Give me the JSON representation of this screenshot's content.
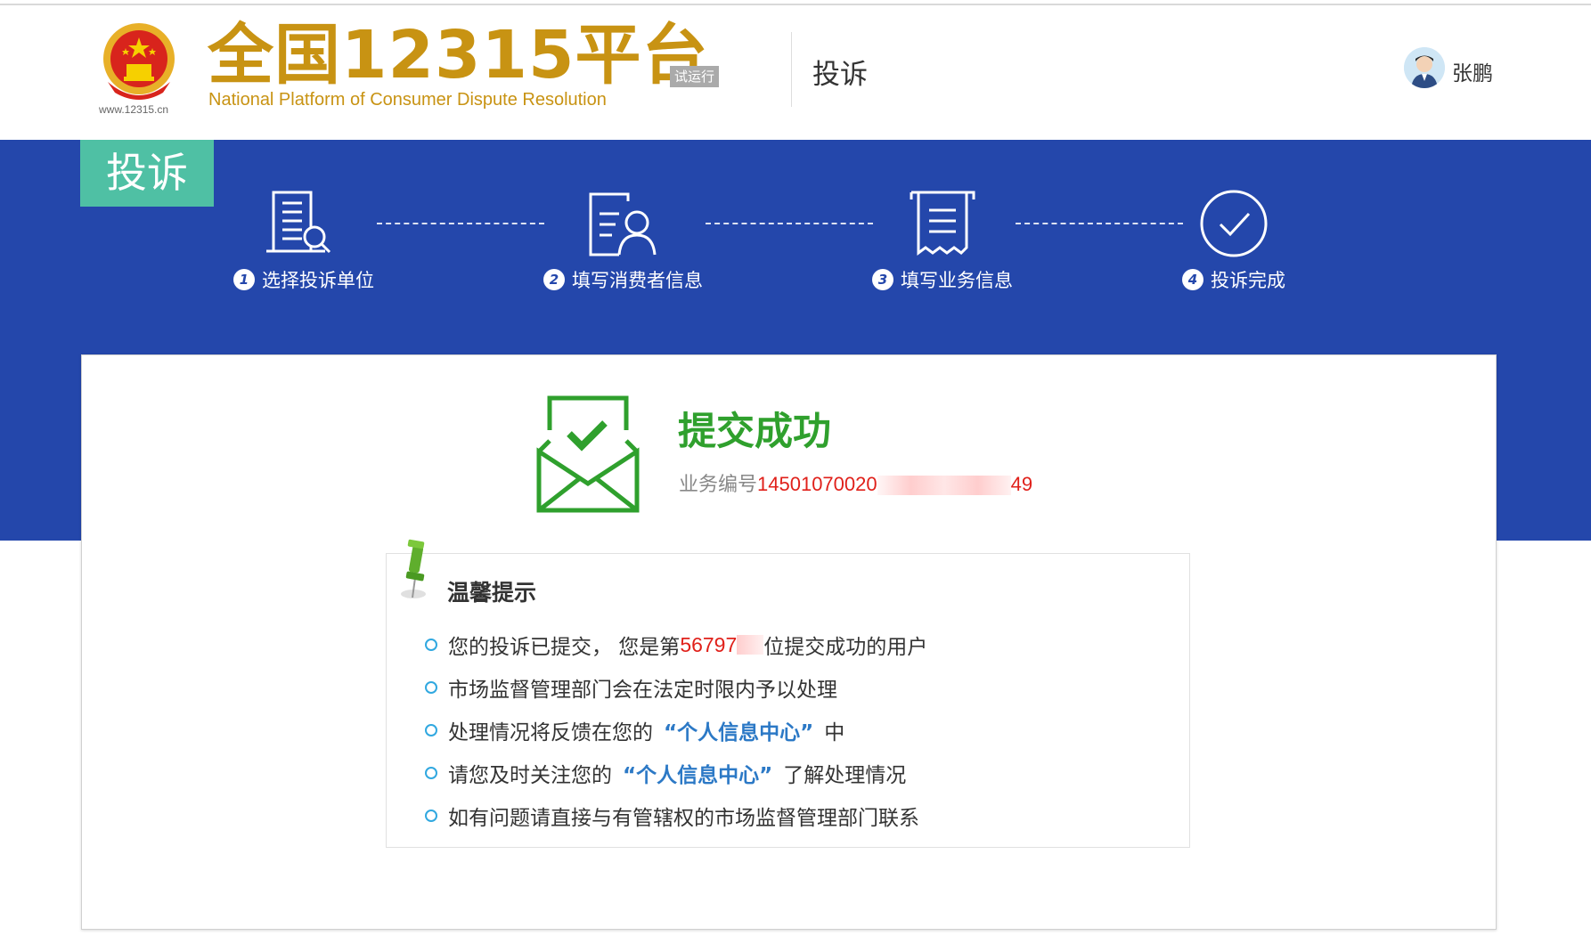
{
  "header": {
    "emblem_url": "www.12315.cn",
    "title": "全国12315平台",
    "badge": "试运行",
    "subtitle": "National Platform of Consumer Dispute Resolution",
    "tab": "投诉",
    "user": "张鹏"
  },
  "banner": {
    "tag": "投诉",
    "steps": [
      {
        "num": "1",
        "label": "选择投诉单位",
        "icon": "building-search-icon"
      },
      {
        "num": "2",
        "label": "填写消费者信息",
        "icon": "person-form-icon"
      },
      {
        "num": "3",
        "label": "填写业务信息",
        "icon": "receipt-icon"
      },
      {
        "num": "4",
        "label": "投诉完成",
        "icon": "check-circle-icon"
      }
    ]
  },
  "result": {
    "title": "提交成功",
    "ticket_label": "业务编号",
    "ticket_prefix": "14501070020",
    "ticket_suffix": "49"
  },
  "tips": {
    "title": "温馨提示",
    "line1_pre": "您的投诉已提交， 您是第",
    "line1_num": "56797",
    "line1_post": "位提交成功的用户",
    "line2": "市场监督管理部门会在法定时限内予以处理",
    "line3_pre": "处理情况将反馈在您的",
    "line3_hl": "“个人信息中心”",
    "line3_post": "中",
    "line4_pre": "请您及时关注您的",
    "line4_hl": "“个人信息中心”",
    "line4_post": "了解处理情况",
    "line5": "如有问题请直接与有管辖权的市场监督管理部门联系"
  },
  "colors": {
    "banner": "#2447ab",
    "tag": "#4fc0a4",
    "brand": "#c89313",
    "success": "#2fa02d",
    "highlight": "#2c79c6",
    "red": "#e0201a"
  }
}
